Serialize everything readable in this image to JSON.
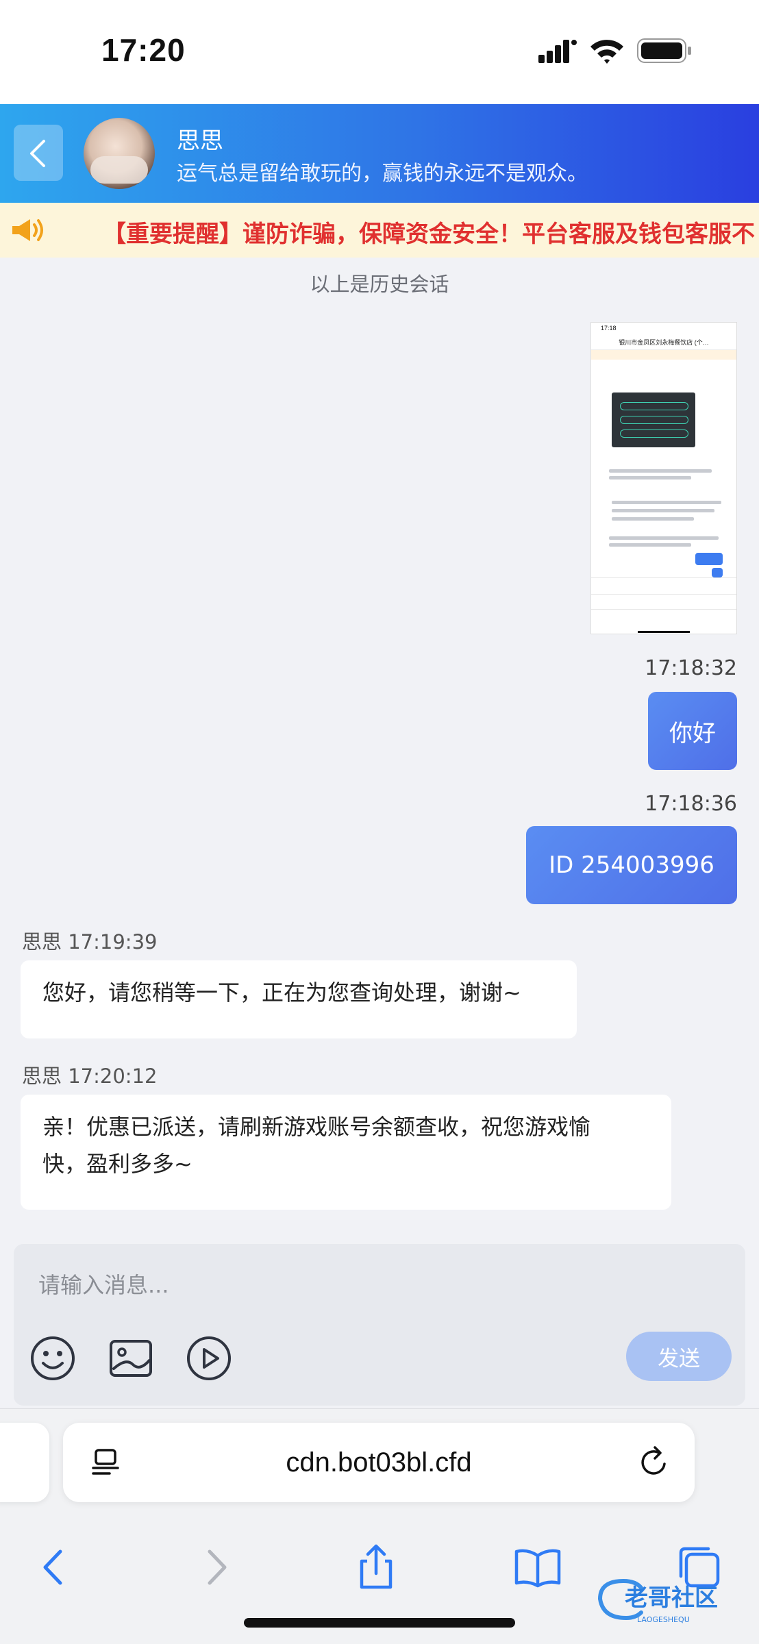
{
  "status_bar": {
    "time": "17:20"
  },
  "header": {
    "contact_name": "思思",
    "motto": "运气总是留给敢玩的，赢钱的永远不是观众。"
  },
  "notice": {
    "text": "【重要提醒】谨防诈骗，保障资金安全！平台客服及钱包客服不"
  },
  "history_label": "以上是历史会话",
  "messages": [
    {
      "time": "17:18:32",
      "text": "你好"
    },
    {
      "time": "17:18:36",
      "text": "ID 254003996"
    },
    {
      "sender": "思思",
      "time": "17:19:39",
      "text": "您好，请您稍等一下，正在为您查询处理，谢谢~"
    },
    {
      "sender": "思思",
      "time": "17:20:12",
      "text_line1": "亲！优惠已派送，请刷新游戏账号余额查收，祝您游戏愉",
      "text_line2": "快，盈利多多~"
    }
  ],
  "image_message": {
    "time": "17:18",
    "title": "银川市金凤区刘永梅餐饮店 (个…"
  },
  "composer": {
    "placeholder": "请输入消息...",
    "send_label": "发送"
  },
  "browser": {
    "url": "cdn.bot03bl.cfd"
  },
  "watermark": {
    "text": "老哥社区",
    "subtext": "LAOGESHEQU"
  },
  "colors": {
    "accent": "#4f6fe8",
    "header_start": "#2ea6ee",
    "header_end": "#2a3fe0",
    "notice_text": "#e0302f",
    "send_button": "#a9c2f3"
  }
}
